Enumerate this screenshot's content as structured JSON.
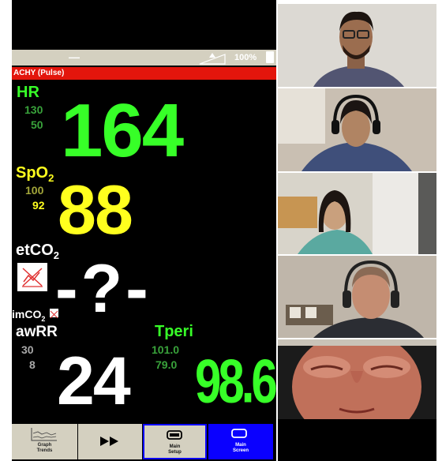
{
  "monitor": {
    "battery_percent": "100%",
    "status_dash": "—",
    "alarm_text": "ACHY (Pulse)",
    "hr": {
      "label": "HR",
      "upper": "130",
      "lower": "50",
      "value": "164"
    },
    "spo2": {
      "label": "SpO",
      "label_sub": "2",
      "upper": "100",
      "lower": "92",
      "value": "88"
    },
    "etco2": {
      "label": "etCO",
      "label_sub": "2",
      "value": "-?-"
    },
    "imco2": {
      "label": "imCO",
      "label_sub": "2"
    },
    "awrr": {
      "label": "awRR",
      "upper": "30",
      "lower": "8",
      "value": "24"
    },
    "tperi": {
      "label": "Tperi",
      "upper": "101.0",
      "lower": "79.0",
      "value": "98.6"
    },
    "buttons": [
      {
        "line1": "Graph",
        "line2": "Trends",
        "icon": "graph-trends-icon"
      },
      {
        "icon": "fast-forward-icon"
      },
      {
        "line1": "Main",
        "line2": "Setup",
        "icon": "monitor-icon"
      },
      {
        "line1": "Main",
        "line2": "Screen",
        "icon": "monitor-icon"
      }
    ]
  },
  "colors": {
    "hr": "#37ff28",
    "spo2": "#ffff1e",
    "alarm": "#e3150c",
    "main_screen_button": "#0a00ff"
  },
  "participants": [
    {
      "name": "participant-1"
    },
    {
      "name": "participant-2"
    },
    {
      "name": "participant-3"
    },
    {
      "name": "participant-4"
    },
    {
      "name": "participant-5"
    }
  ]
}
